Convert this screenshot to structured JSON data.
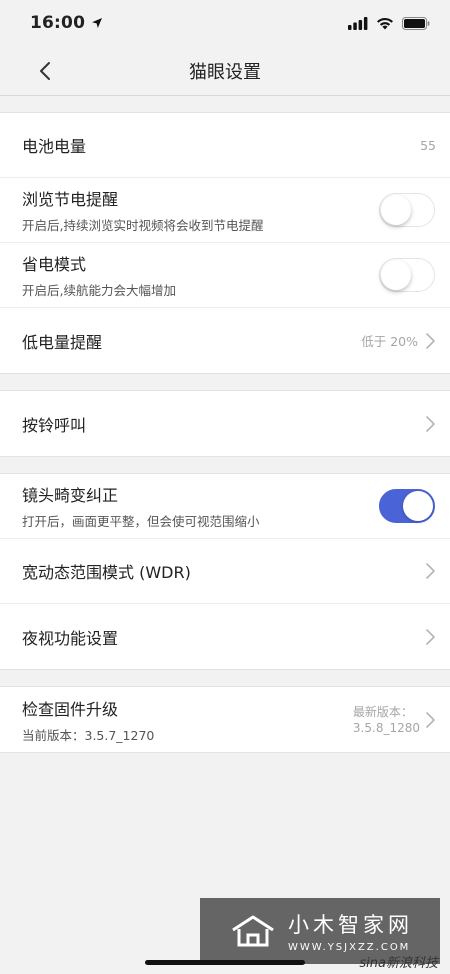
{
  "status": {
    "time": "16:00"
  },
  "nav": {
    "title": "猫眼设置"
  },
  "groups": {
    "power": {
      "battery": {
        "label": "电池电量",
        "value": "55"
      },
      "browse_reminder": {
        "label": "浏览节电提醒",
        "sub": "开启后,持续浏览实时视频将会收到节电提醒",
        "enabled": false
      },
      "power_save": {
        "label": "省电模式",
        "sub": "开启后,续航能力会大幅增加",
        "enabled": false
      },
      "low_battery": {
        "label": "低电量提醒",
        "value": "低于 20%"
      }
    },
    "call": {
      "doorbell": {
        "label": "按铃呼叫"
      }
    },
    "image": {
      "distortion": {
        "label": "镜头畸变纠正",
        "sub": "打开后，画面更平整，但会使可视范围缩小",
        "enabled": true
      },
      "wdr": {
        "label": "宽动态范围模式 (WDR)"
      },
      "night": {
        "label": "夜视功能设置"
      }
    },
    "firmware": {
      "label": "检查固件升级",
      "current": "当前版本：3.5.7_1270",
      "latest_label": "最新版本：",
      "latest_version": "3.5.8_1280"
    }
  },
  "watermark": {
    "main": "小木智家网",
    "sub": "WWW.YSJXZZ.COM",
    "sina": "sina新浪科技"
  },
  "colors": {
    "toggle_on": "#4a63d6",
    "background": "#f2f2f2"
  }
}
